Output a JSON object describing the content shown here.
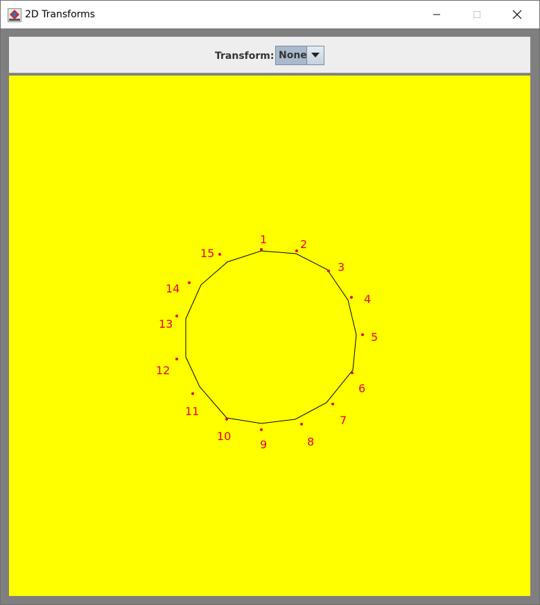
{
  "window": {
    "title": "2D Transforms",
    "controls": [
      "minimize",
      "maximize",
      "close"
    ]
  },
  "toolbar": {
    "transform_label": "Transform:",
    "transform_value": "None"
  },
  "canvas": {
    "background": "#ffff00",
    "polygon_color": "#000000",
    "point_color": "#e8001c",
    "point_count": 15,
    "labels": [
      "1",
      "2",
      "3",
      "4",
      "5",
      "6",
      "7",
      "8",
      "9",
      "10",
      "11",
      "12",
      "13",
      "14",
      "15"
    ]
  }
}
